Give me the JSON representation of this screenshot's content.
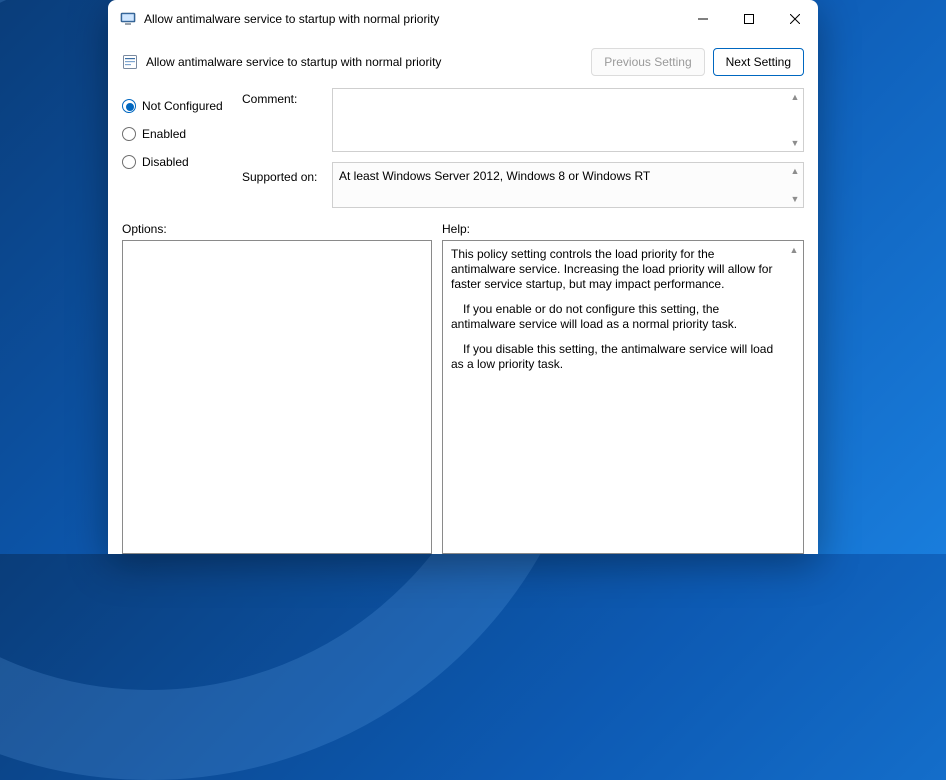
{
  "window": {
    "title": "Allow antimalware service to startup with normal priority"
  },
  "policy": {
    "title": "Allow antimalware service to startup with normal priority"
  },
  "nav": {
    "previous_label": "Previous Setting",
    "next_label": "Next Setting"
  },
  "state": {
    "options": [
      {
        "label": "Not Configured",
        "selected": true
      },
      {
        "label": "Enabled",
        "selected": false
      },
      {
        "label": "Disabled",
        "selected": false
      }
    ]
  },
  "labels": {
    "comment": "Comment:",
    "supported_on": "Supported on:",
    "options": "Options:",
    "help": "Help:"
  },
  "fields": {
    "comment_value": "",
    "supported_on_value": "At least Windows Server 2012, Windows 8 or Windows RT"
  },
  "help": {
    "p1": "This policy setting controls the load priority for the antimalware service. Increasing the load priority will allow for faster service startup, but may impact performance.",
    "p2": "If you enable or do not configure this setting, the antimalware service will load as a normal priority task.",
    "p3": "If you disable this setting, the antimalware service will load as a low priority task."
  }
}
